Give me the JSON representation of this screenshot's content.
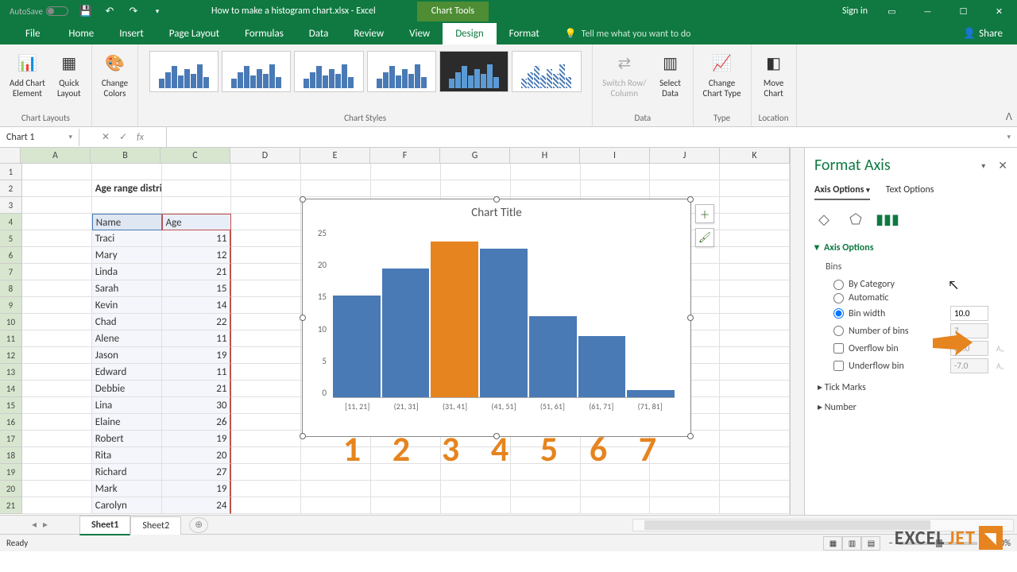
{
  "titlebar": {
    "autosave": "AutoSave",
    "filename": "How to make a histogram chart.xlsx - Excel",
    "chart_tools": "Chart Tools",
    "signin": "Sign in"
  },
  "tabs": {
    "file": "File",
    "home": "Home",
    "insert": "Insert",
    "pagelayout": "Page Layout",
    "formulas": "Formulas",
    "data": "Data",
    "review": "Review",
    "view": "View",
    "design": "Design",
    "format": "Format",
    "tellme": "Tell me what you want to do",
    "share": "Share"
  },
  "ribbon": {
    "add_chart_element": "Add Chart\nElement",
    "quick_layout": "Quick\nLayout",
    "change_colors": "Change\nColors",
    "chart_layouts": "Chart Layouts",
    "chart_styles": "Chart Styles",
    "switch_row": "Switch Row/\nColumn",
    "select_data": "Select\nData",
    "data_group": "Data",
    "change_chart_type": "Change\nChart Type",
    "type_group": "Type",
    "move_chart": "Move\nChart",
    "location_group": "Location"
  },
  "namebox": "Chart 1",
  "sheet": {
    "title_cell": "Age range distribution",
    "headers": {
      "name": "Name",
      "age": "Age"
    },
    "columns": [
      "A",
      "B",
      "C",
      "D",
      "E",
      "F",
      "G",
      "H",
      "I",
      "J",
      "K"
    ],
    "rows": [
      {
        "name": "Traci",
        "age": 11
      },
      {
        "name": "Mary",
        "age": 12
      },
      {
        "name": "Linda",
        "age": 21
      },
      {
        "name": "Sarah",
        "age": 15
      },
      {
        "name": "Kevin",
        "age": 14
      },
      {
        "name": "Chad",
        "age": 22
      },
      {
        "name": "Alene",
        "age": 11
      },
      {
        "name": "Jason",
        "age": 19
      },
      {
        "name": "Edward",
        "age": 11
      },
      {
        "name": "Debbie",
        "age": 21
      },
      {
        "name": "Lina",
        "age": 30
      },
      {
        "name": "Elaine",
        "age": 26
      },
      {
        "name": "Robert",
        "age": 19
      },
      {
        "name": "Rita",
        "age": 20
      },
      {
        "name": "Richard",
        "age": 27
      },
      {
        "name": "Mark",
        "age": 19
      },
      {
        "name": "Carolyn",
        "age": 24
      }
    ]
  },
  "chart_data": {
    "type": "bar",
    "title": "Chart Title",
    "categories": [
      "[11, 21]",
      "(21, 31]",
      "(31, 41]",
      "(41, 51]",
      "(51, 61]",
      "(61, 71]",
      "(71, 81]"
    ],
    "values": [
      15,
      19,
      23,
      22,
      12,
      9,
      1
    ],
    "highlight_index": 2,
    "ylim": [
      0,
      25
    ],
    "yticks": [
      25,
      20,
      15,
      10,
      5,
      0
    ],
    "xlabel": "",
    "ylabel": ""
  },
  "overlay_numbers": [
    "1",
    "2",
    "3",
    "4",
    "5",
    "6",
    "7"
  ],
  "pane": {
    "title": "Format Axis",
    "axis_options": "Axis Options",
    "text_options": "Text Options",
    "section": "Axis Options",
    "bins": "Bins",
    "by_category": "By Category",
    "automatic": "Automatic",
    "bin_width": "Bin width",
    "bin_width_val": "10.0",
    "num_bins": "Number of bins",
    "num_bins_val": "7",
    "overflow": "Overflow bin",
    "overflow_val": "85.0",
    "underflow": "Underflow bin",
    "underflow_val": "-7.0",
    "tick_marks": "Tick Marks",
    "number": "Number"
  },
  "sheettabs": {
    "sheet1": "Sheet1",
    "sheet2": "Sheet2"
  },
  "status": {
    "ready": "Ready",
    "zoom": "100%"
  },
  "watermark": {
    "excel": "EXCEL",
    "jet": "JET"
  }
}
